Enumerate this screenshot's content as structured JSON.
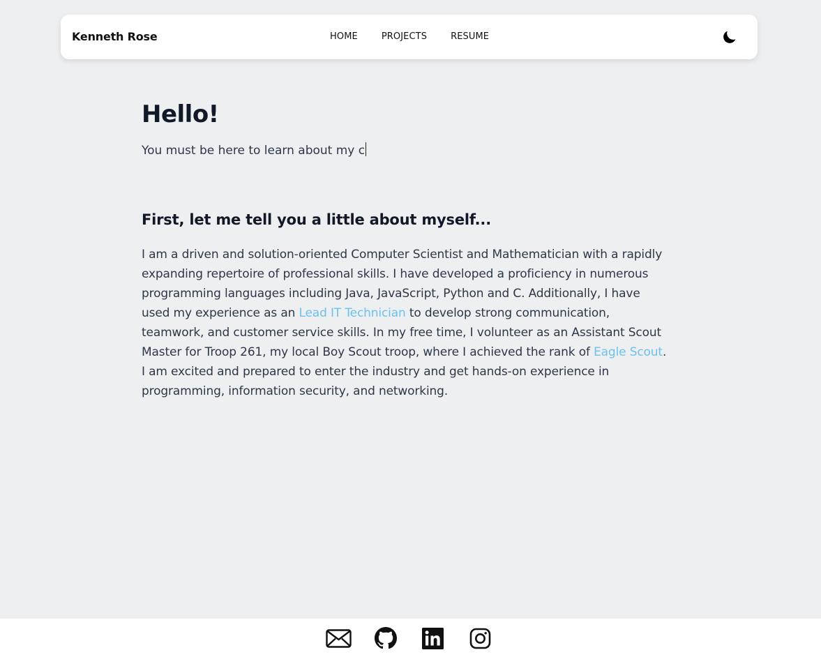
{
  "nav": {
    "brand": "Kenneth Rose",
    "links": [
      "HOME",
      "PROJECTS",
      "RESUME"
    ],
    "theme_icon": "moon-icon"
  },
  "hero": {
    "title": "Hello!",
    "typed_text": "You must be here to learn about my c"
  },
  "about": {
    "heading": "First, let me tell you a little about myself...",
    "part1": "I am a driven and solution-oriented Computer Scientist and Mathematician with a rapidly expanding repertoire of professional skills. I have developed a proficiency in numerous programming languages including Java, JavaScript, Python and C. Additionally, I have used my experience as an ",
    "link1": "Lead IT Technician",
    "part2": " to develop strong communication, teamwork, and customer service skills. In my free time, I volunteer as an Assistant Scout Master for Troop 261, my local Boy Scout troop, where I achieved the rank of ",
    "link2": "Eagle Scout",
    "part3": ". I am excited and prepared to enter the industry and get hands-on experience in programming, information security, and networking."
  },
  "footer": {
    "icons": [
      "envelope-icon",
      "github-icon",
      "linkedin-icon",
      "instagram-icon"
    ]
  },
  "colors": {
    "background": "#eeeff1",
    "link": "#6cc1ee",
    "heading": "#111827",
    "text": "#2d3748"
  }
}
